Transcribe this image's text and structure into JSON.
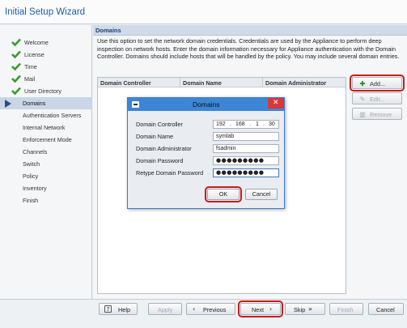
{
  "window": {
    "title": "Initial Setup Wizard"
  },
  "sidebar": {
    "items": [
      {
        "label": "Welcome",
        "state": "done"
      },
      {
        "label": "License",
        "state": "done"
      },
      {
        "label": "Time",
        "state": "done"
      },
      {
        "label": "Mail",
        "state": "done"
      },
      {
        "label": "User Directory",
        "state": "done"
      },
      {
        "label": "Domains",
        "state": "active"
      },
      {
        "label": "Authentication Servers",
        "state": "pending"
      },
      {
        "label": "Internal Network",
        "state": "pending"
      },
      {
        "label": "Enforcement Mode",
        "state": "pending"
      },
      {
        "label": "Channels",
        "state": "pending"
      },
      {
        "label": "Switch",
        "state": "pending"
      },
      {
        "label": "Policy",
        "state": "pending"
      },
      {
        "label": "Inventory",
        "state": "pending"
      },
      {
        "label": "Finish",
        "state": "pending"
      }
    ]
  },
  "main": {
    "section_title": "Domains",
    "description": "Use this option to set the network domain credentials. Credentials are used by the Appliance to perform deep inspection on network hosts. Enter the domain information necessary for Appliance authentication with the Domain Controller. Domains should include hosts that will be handled by the policy. You may include several domain entries.",
    "table": {
      "columns": [
        "Domain Controller",
        "Domain Name",
        "Domain Administrator"
      ],
      "rows": []
    },
    "buttons": {
      "add": "Add...",
      "edit": "Edit...",
      "remove": "Remove"
    }
  },
  "dialog": {
    "title": "Domains",
    "fields": {
      "controller_label": "Domain Controller",
      "controller_ip": [
        "192",
        "168",
        "1",
        "30"
      ],
      "name_label": "Domain Name",
      "name_value": "symlab",
      "admin_label": "Domain Administrator",
      "admin_value": "fsadmin",
      "password_label": "Domain Password",
      "password_value": "●●●●●●●●●",
      "retype_label": "Retype Domain Password",
      "retype_value": "●●●●●●●●●"
    },
    "ok": "OK",
    "cancel": "Cancel"
  },
  "footer": {
    "help": "Help",
    "apply": "Apply",
    "previous": "Previous",
    "next": "Next",
    "skip": "Skip",
    "finish": "Finish",
    "cancel": "Cancel"
  },
  "colors": {
    "title": "#1d5fa8",
    "section_header_bg": "#cfdbe9",
    "dialog_titlebar": "#3d86d6",
    "close_button": "#d9373a",
    "highlight": "#c91b1b",
    "check_green": "#3a9b2c"
  }
}
